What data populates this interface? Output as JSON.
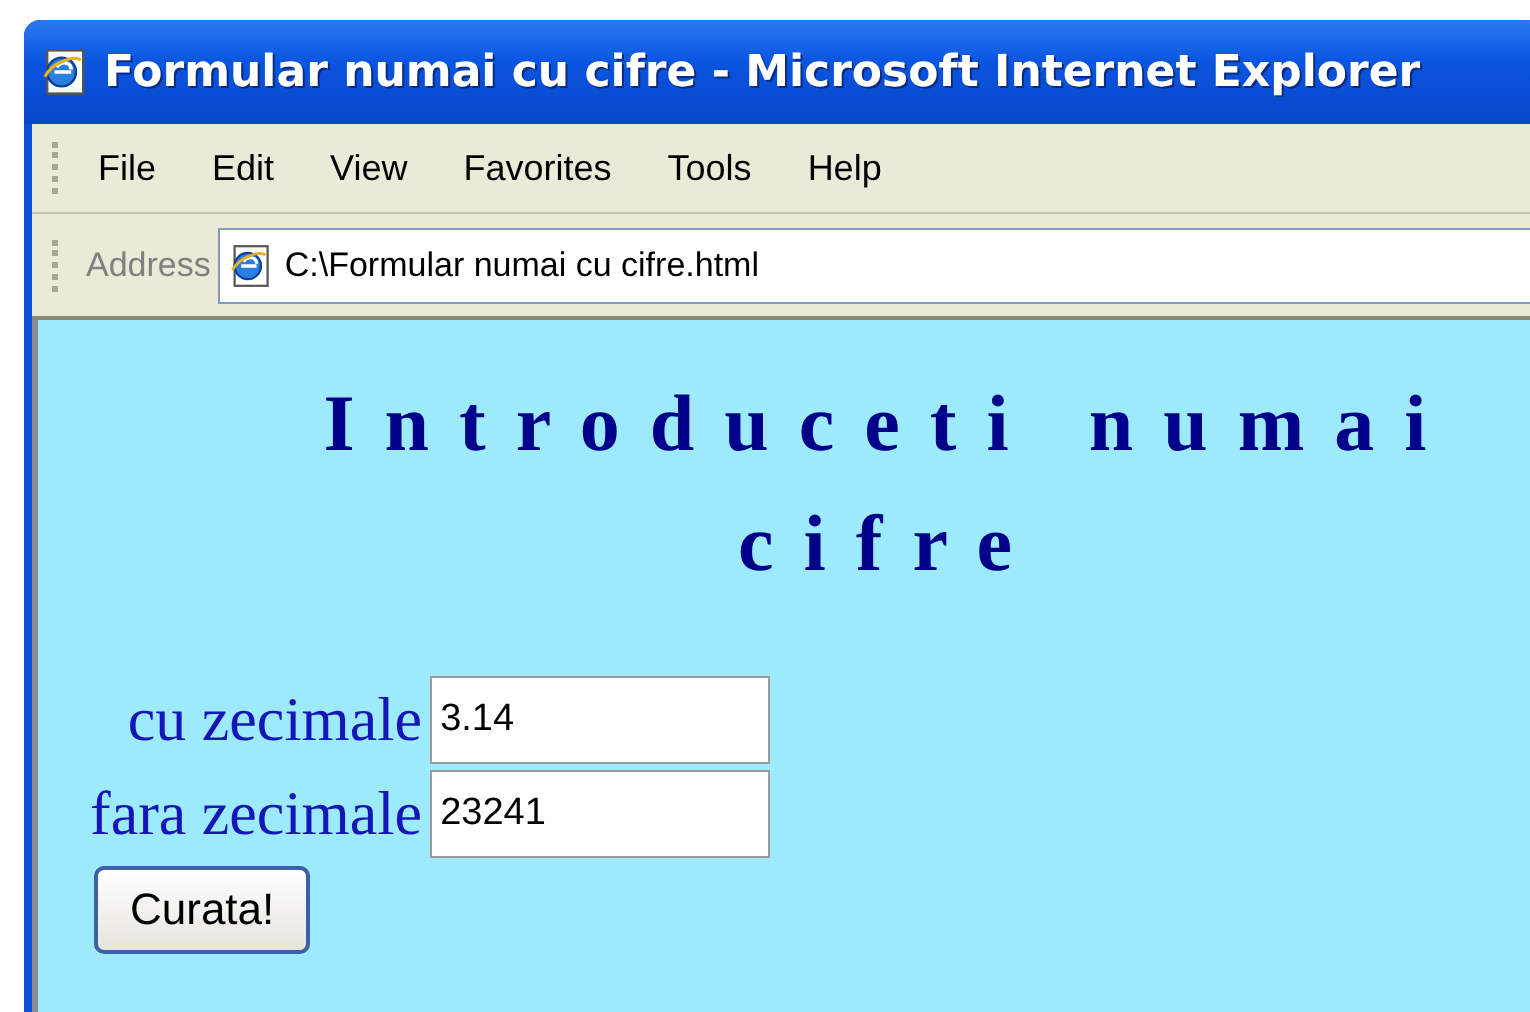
{
  "window": {
    "title": "Formular numai cu cifre - Microsoft Internet Explorer"
  },
  "menu": [
    "File",
    "Edit",
    "View",
    "Favorites",
    "Tools",
    "Help"
  ],
  "address_bar": {
    "label": "Address",
    "value": "C:\\Formular numai cu cifre.html"
  },
  "page": {
    "heading": "Introduceti numai cifre",
    "fields": [
      {
        "label": "cu zecimale",
        "value": "3.14"
      },
      {
        "label": "fara zecimale",
        "value": "23241"
      }
    ],
    "button": "Curata!"
  }
}
